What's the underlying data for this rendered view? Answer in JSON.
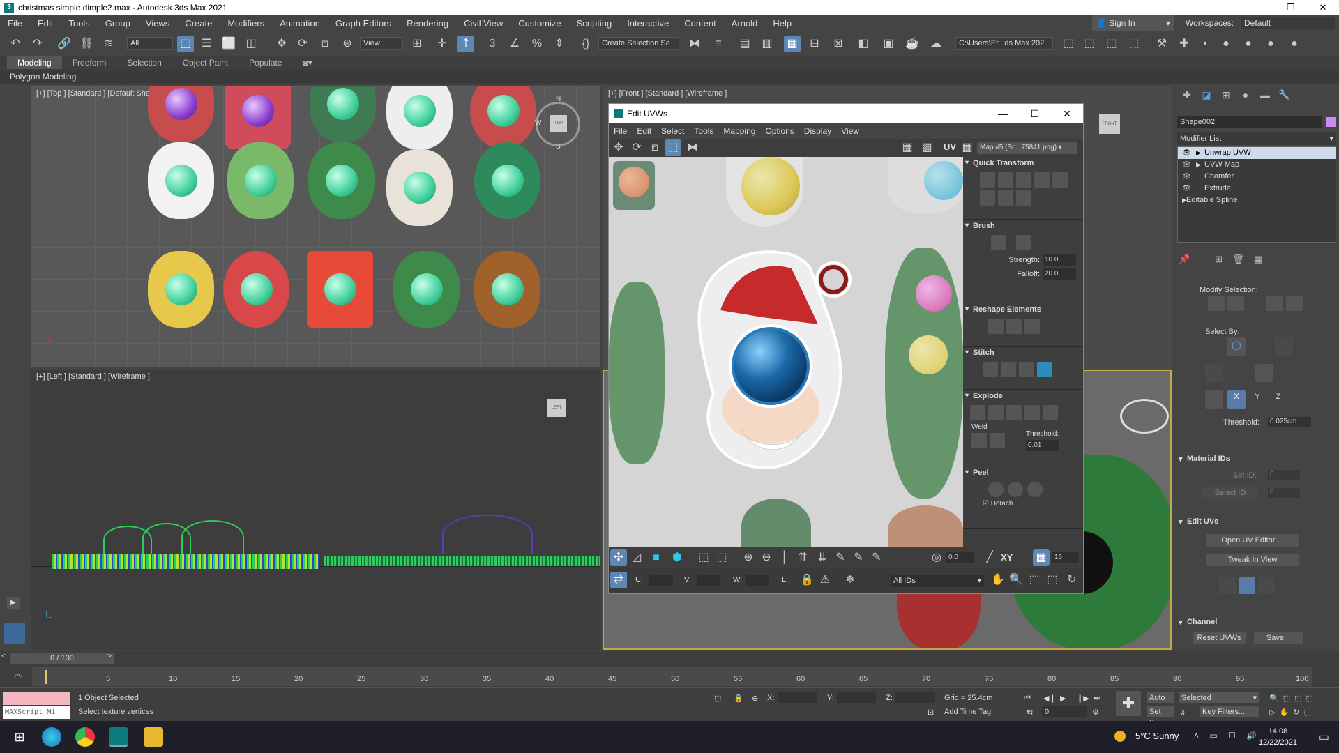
{
  "window": {
    "title": "christmas simple dimple2.max - Autodesk 3ds Max 2021",
    "controls": [
      "—",
      "❐",
      "✕"
    ]
  },
  "menu": [
    "File",
    "Edit",
    "Tools",
    "Group",
    "Views",
    "Create",
    "Modifiers",
    "Animation",
    "Graph Editors",
    "Rendering",
    "Civil View",
    "Customize",
    "Scripting",
    "Interactive",
    "Content",
    "Arnold",
    "Help"
  ],
  "account": {
    "signin": "Sign In",
    "workspaces_label": "Workspaces:",
    "workspace": "Default"
  },
  "toolbar": {
    "filter": "All",
    "ref_coord": "View",
    "named_sel": "Create Selection Se",
    "project_path": "C:\\Users\\Er...ds Max 202"
  },
  "ribbon": {
    "tabs": [
      "Modeling",
      "Freeform",
      "Selection",
      "Object Paint",
      "Populate"
    ],
    "active": "Modeling",
    "sub": "Polygon Modeling"
  },
  "viewports": {
    "top": "[+] [Top ] [Standard ] [Default Shading ]",
    "left": "[+] [Left ] [Standard ] [Wireframe ]",
    "front": "[+] [Front ] [Standard ] [Wireframe ]",
    "viewcube_top": "TOP",
    "viewcube_left": "LEFT",
    "viewcube_front": "FRONT",
    "compass": [
      "N",
      "W",
      "S"
    ]
  },
  "uvw_editor": {
    "title": "Edit UVWs",
    "menu": [
      "File",
      "Edit",
      "Select",
      "Tools",
      "Mapping",
      "Options",
      "Display",
      "View"
    ],
    "uv_label": "UV",
    "map": "Map #5 (Sc...75841.png)",
    "rollouts": {
      "quick_transform": "Quick Transform",
      "brush": "Brush",
      "strength_label": "Strength:",
      "strength": "10.0",
      "falloff_label": "Falloff:",
      "falloff": "20.0",
      "reshape": "Reshape Elements",
      "stitch": "Stitch",
      "explode": "Explode",
      "weld": "Weld",
      "threshold_label": "Threshold:",
      "threshold": "0.01",
      "peel": "Peel",
      "detach": "Detach"
    },
    "bottom": {
      "angle": "0.0",
      "xy": "XY",
      "snap": "16",
      "u": "U:",
      "v": "V:",
      "w": "W:",
      "l": "L:",
      "ids": "All IDs"
    }
  },
  "command_panel": {
    "object_name": "Shape002",
    "modifier_list": "Modifier List",
    "stack": [
      "Unwrap UVW",
      "UVW Map",
      "Chamfer",
      "Extrude",
      "Editable Spline"
    ],
    "modify_selection": "Modify Selection:",
    "select_by": "Select By:",
    "axes": [
      "X",
      "Y",
      "Z"
    ],
    "threshold_label": "Threshold:",
    "threshold": "0.025cm",
    "material_ids": "Material IDs",
    "set_id": "Set ID:",
    "select_id": "Select ID",
    "set_id_val": "0",
    "select_id_val": "0",
    "edit_uvs": "Edit UVs",
    "open_uv_editor": "Open UV Editor ...",
    "tweak_in_view": "Tweak In View",
    "channel": "Channel",
    "reset_uvws": "Reset UVWs",
    "save": "Save..."
  },
  "timeline": {
    "frame": "0 / 100",
    "ticks": [
      "5",
      "10",
      "15",
      "20",
      "25",
      "30",
      "35",
      "40",
      "45",
      "50",
      "55",
      "60",
      "65",
      "70",
      "75",
      "80",
      "85",
      "90",
      "95",
      "100"
    ]
  },
  "status": {
    "maxscript": "MAXScript Mi",
    "selected": "1 Object Selected",
    "prompt": "Select texture vertices",
    "x": "X:",
    "y": "Y:",
    "z": "Z:",
    "grid": "Grid = 25.4cm",
    "add_time_tag": "Add Time Tag",
    "auto_key": "Auto K...",
    "selected_mode": "Selected",
    "set_key": "Set Key",
    "key_filters": "Key Filters...",
    "frame_val": "0"
  },
  "taskbar": {
    "weather": "5°C  Sunny",
    "time": "14:08",
    "date": "12/22/2021"
  }
}
